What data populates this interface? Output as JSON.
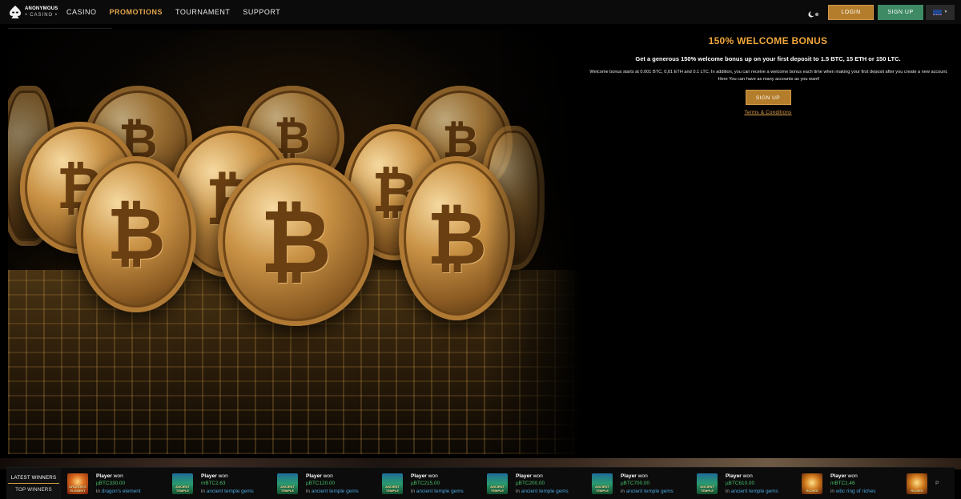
{
  "header": {
    "logo_line1": "ANONYMOUS",
    "logo_line2": "• CASINO •",
    "nav": [
      {
        "label": "CASINO",
        "active": false
      },
      {
        "label": "PROMOTIONS",
        "active": true
      },
      {
        "label": "TOURNAMENT",
        "active": false
      },
      {
        "label": "SUPPORT",
        "active": false
      }
    ],
    "login_label": "LOGIN",
    "signup_label": "SIGN UP",
    "language_icon": "uk-flag-icon",
    "theme_icon": "moon-icon"
  },
  "hero": {
    "coin_symbol": "₿",
    "coin_icon": "bitcoin-icon"
  },
  "promo": {
    "title": "150% WELCOME BONUS",
    "lead": "Get a generous 150% welcome bonus up on your first deposit to 1.5 BTC, 15 ETH or 150 LTC.",
    "body": "Welcome bonus starts at 0.001 BTC, 0,01 ETH and 0.1 LTC. In addition, you can receive a welcome bonus each time when making your first deposit after you create a new account. Here You can have as many accounts as you want!",
    "signup_label": "SIGN UP",
    "terms_label": "Terms & Conditions"
  },
  "winners": {
    "tabs": [
      {
        "label": "LATEST WINNERS",
        "active": true
      },
      {
        "label": "TOP WINNERS",
        "active": false
      }
    ],
    "items": [
      {
        "player": "Player",
        "verb": "won",
        "amount": "µBTC330.00",
        "in": "in",
        "game": "dragon's element",
        "thumb": "dragon",
        "thumb_label": "DRAGON'S ELEMENT"
      },
      {
        "player": "Player",
        "verb": "won",
        "amount": "mBTC2.63",
        "in": "in",
        "game": "ancient temple gems",
        "thumb": "temple",
        "thumb_label": "ANCIENT TEMPLE"
      },
      {
        "player": "Player",
        "verb": "won",
        "amount": "µBTC120.00",
        "in": "in",
        "game": "ancient temple gems",
        "thumb": "temple",
        "thumb_label": "ANCIENT TEMPLE"
      },
      {
        "player": "Player",
        "verb": "won",
        "amount": "µBTC215.00",
        "in": "in",
        "game": "ancient temple gems",
        "thumb": "temple",
        "thumb_label": "ANCIENT TEMPLE"
      },
      {
        "player": "Player",
        "verb": "won",
        "amount": "µBTC200.00",
        "in": "in",
        "game": "ancient temple gems",
        "thumb": "temple",
        "thumb_label": "ANCIENT TEMPLE"
      },
      {
        "player": "Player",
        "verb": "won",
        "amount": "µBTC700.00",
        "in": "in",
        "game": "ancient temple gems",
        "thumb": "temple",
        "thumb_label": "ANCIENT TEMPLE"
      },
      {
        "player": "Player",
        "verb": "won",
        "amount": "µBTC610.00",
        "in": "in",
        "game": "ancient temple gems",
        "thumb": "temple",
        "thumb_label": "ANCIENT TEMPLE"
      },
      {
        "player": "Player",
        "verb": "won",
        "amount": "mBTC1.46",
        "in": "in",
        "game": "wbc ring of riches",
        "thumb": "riches",
        "thumb_label": "RICHES"
      },
      {
        "player": "P",
        "verb": "",
        "amount": "",
        "in": "",
        "game": "",
        "thumb": "riches",
        "thumb_label": "RICHES"
      }
    ]
  }
}
